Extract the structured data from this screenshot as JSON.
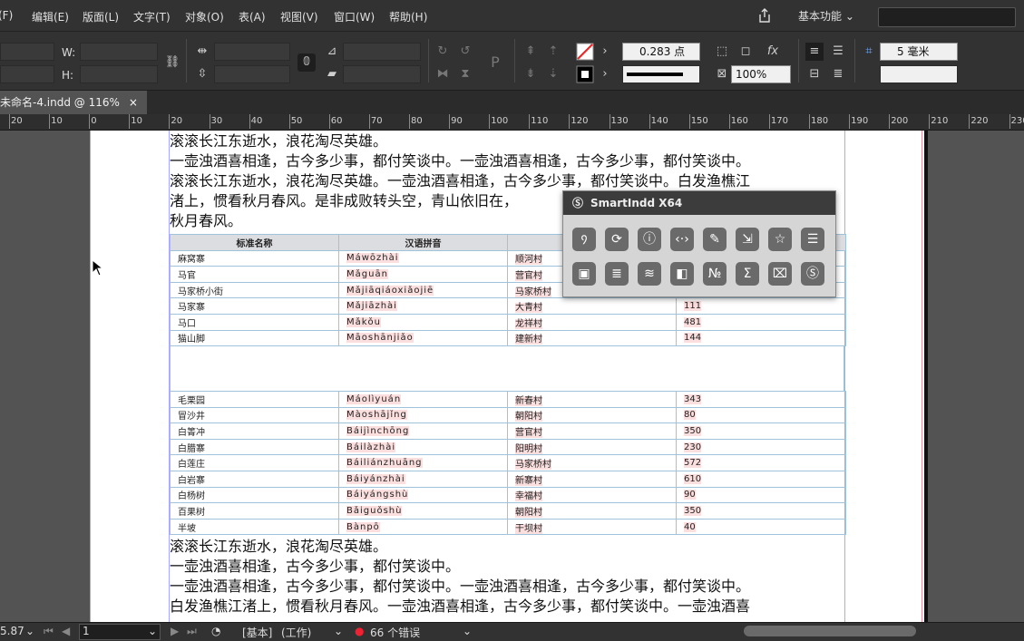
{
  "menu": {
    "items": [
      "(F)",
      "编辑(E)",
      "版面(L)",
      "文字(T)",
      "对象(O)",
      "表(A)",
      "视图(V)",
      "窗口(W)",
      "帮助(H)"
    ],
    "workspace": "基本功能"
  },
  "control": {
    "w_label": "W:",
    "h_label": "H:",
    "stroke_weight": "0.283 点",
    "opacity": "100%",
    "spacing": "5 毫米"
  },
  "tab": {
    "title": "未命名-4.indd @ 116%",
    "close": "×"
  },
  "ruler": {
    "labels": [
      "20",
      "10",
      "0",
      "10",
      "20",
      "30",
      "40",
      "50",
      "60",
      "70",
      "80",
      "90",
      "100",
      "110",
      "120",
      "130",
      "140",
      "150",
      "160",
      "170",
      "180",
      "190",
      "200",
      "210",
      "220",
      "230"
    ]
  },
  "document": {
    "top_lines": [
      "滚滚长江东逝水，浪花淘尽英雄。",
      "一壶浊酒喜相逢，古今多少事，都付笑谈中。一壶浊酒喜相逢，古今多少事，都付笑谈中。",
      "滚滚长江东逝水，浪花淘尽英雄。一壶浊酒喜相逢，古今多少事，都付笑谈中。白发渔樵江",
      "渚上，惯看秋月春风。是非成败转头空，青山依旧在，",
      "秋月春风。"
    ],
    "bottom_lines": [
      "滚滚长江东逝水，浪花淘尽英雄。",
      "一壶浊酒喜相逢，古今多少事，都付笑谈中。",
      "一壶浊酒喜相逢，古今多少事，都付笑谈中。一壶浊酒喜相逢，古今多少事，都付笑谈中。",
      "白发渔樵江渚上，惯看秋月春风。一壶浊酒喜相逢，古今多少事，都付笑谈中。一壶浊酒喜"
    ],
    "table_headers": [
      "标准名称",
      "汉语拼音",
      "",
      ""
    ],
    "table1_rows": [
      [
        "麻窝寨",
        "Máwōzhài",
        "顺河村",
        ""
      ],
      [
        "马官",
        "Mǎguān",
        "营官村",
        ""
      ],
      [
        "马家桥小街",
        "Mǎjiāqiáoxiǎojiē",
        "马家桥村",
        ""
      ],
      [
        "马家寨",
        "Mǎjiāzhài",
        "大青村",
        "111"
      ],
      [
        "马口",
        "Mǎkǒu",
        "龙祥村",
        "481"
      ],
      [
        "猫山脚",
        "Māoshānjiǎo",
        "建新村",
        "144"
      ]
    ],
    "table2_rows": [
      [
        "毛栗园",
        "Máolìyuán",
        "新春村",
        "343"
      ],
      [
        "冒沙井",
        "Màoshājǐng",
        "朝阳村",
        "80"
      ],
      [
        "白箐冲",
        "Báijìnchōng",
        "营官村",
        "350"
      ],
      [
        "白腊寨",
        "Báilàzhài",
        "阳明村",
        "230"
      ],
      [
        "白莲庄",
        "Báiliánzhuāng",
        "马家桥村",
        "572"
      ],
      [
        "白岩寨",
        "Báiyánzhài",
        "新寨村",
        "610"
      ],
      [
        "白杨树",
        "Báiyángshù",
        "幸福村",
        "90"
      ],
      [
        "百果树",
        "Bǎiguǒshù",
        "朝阳村",
        "350"
      ],
      [
        "半坡",
        "Bànpō",
        "干坝村",
        "40"
      ]
    ]
  },
  "panel": {
    "title": "SmartIndd X64"
  },
  "status": {
    "zoom": "5.87",
    "page": "1",
    "master": "[基本]",
    "profile": "(工作)",
    "errors": "66 个错误"
  }
}
